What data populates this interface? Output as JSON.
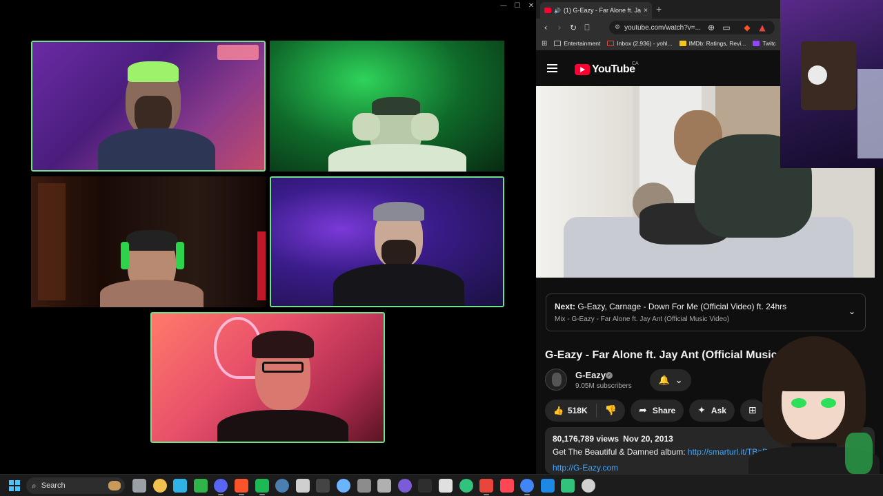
{
  "call_window": {
    "controls": [
      "—",
      "☐",
      "✕"
    ],
    "participants": [
      "participant-1",
      "participant-2",
      "participant-3",
      "participant-4",
      "participant-5"
    ]
  },
  "browser": {
    "tab": {
      "title": "(1) G-Eazy - Far Alone ft. Jay A",
      "close": "×"
    },
    "new_tab": "+",
    "address": "youtube.com/watch?v=...",
    "bookmarks": [
      {
        "label": "Entertainment"
      },
      {
        "label": "Inbox (2,936) - yohl..."
      },
      {
        "label": "IMDb: Ratings, Revi..."
      },
      {
        "label": "Twitc"
      }
    ]
  },
  "youtube": {
    "logo_text": "YouTube",
    "country": "CA",
    "up_next": {
      "prefix": "Next:",
      "title": "G-Eazy, Carnage - Down For Me (Official Video) ft. 24hrs",
      "mix": "Mix - G-Eazy - Far Alone ft. Jay Ant (Official Music Video)"
    },
    "video_title": "G-Eazy - Far Alone ft. Jay Ant (Official Music Video)",
    "channel": {
      "name": "G-Eazy",
      "subscribers": "9.05M subscribers"
    },
    "actions": {
      "likes": "518K",
      "share": "Share",
      "ask": "Ask"
    },
    "description": {
      "views": "80,176,789 views",
      "date": "Nov 20, 2013",
      "album_text": "Get The Beautiful & Damned album: ",
      "album_link": "http://smarturl.it/TBaD",
      "second_link": "http://G-Eazy.com"
    }
  },
  "taskbar": {
    "search_label": "Search",
    "apps": [
      {
        "name": "task-view-icon",
        "color": "#9aa0a6"
      },
      {
        "name": "file-explorer-icon",
        "color": "#f2c14e"
      },
      {
        "name": "edge-icon",
        "color": "#2fb3e6"
      },
      {
        "name": "xbox-icon",
        "color": "#2fb34a"
      },
      {
        "name": "discord-icon",
        "color": "#5865f2"
      },
      {
        "name": "brave-icon",
        "color": "#fb542b"
      },
      {
        "name": "spotify-icon",
        "color": "#1db954"
      },
      {
        "name": "steam-icon",
        "color": "#4a7fb0"
      },
      {
        "name": "obs-icon",
        "color": "#cfcfcf"
      },
      {
        "name": "epic-games-icon",
        "color": "#444444"
      },
      {
        "name": "notepad-icon",
        "color": "#6bb4ff"
      },
      {
        "name": "calculator-icon",
        "color": "#8c8c8c"
      },
      {
        "name": "settings-icon",
        "color": "#b0b0b0"
      },
      {
        "name": "media-icon",
        "color": "#7b5cd6"
      },
      {
        "name": "nvidia-icon",
        "color": "#2e2e2e"
      },
      {
        "name": "steelseries-icon",
        "color": "#e0e0e0"
      },
      {
        "name": "streamlabs-icon",
        "color": "#31c27c"
      },
      {
        "name": "chrome-icon",
        "color": "#e8453c"
      },
      {
        "name": "valorant-icon",
        "color": "#ff4655"
      },
      {
        "name": "chrome-alt-icon",
        "color": "#4285f4"
      },
      {
        "name": "app-blue-icon",
        "color": "#1e88e5"
      },
      {
        "name": "media-player-icon",
        "color": "#31c27c"
      },
      {
        "name": "window-icon",
        "color": "#d0d0d0"
      }
    ]
  },
  "colors": {
    "active_speaker": "#6ee38a",
    "youtube_red": "#ff0033",
    "link": "#3ea6ff"
  }
}
